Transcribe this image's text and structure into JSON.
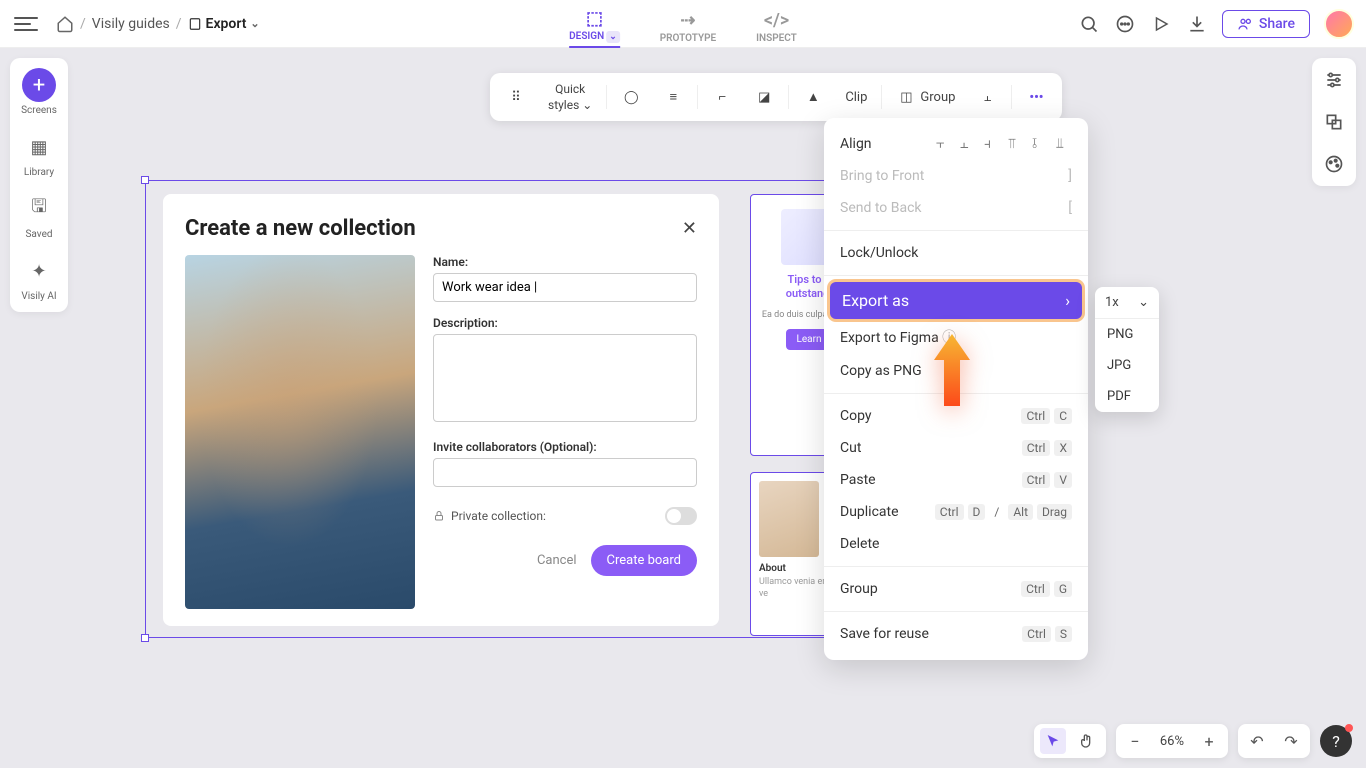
{
  "breadcrumb": {
    "guides": "Visily guides",
    "current": "Export"
  },
  "tabs": {
    "design": "DESIGN",
    "prototype": "PROTOTYPE",
    "inspect": "INSPECT"
  },
  "top_actions": {
    "share": "Share"
  },
  "left_sidebar": {
    "screens": "Screens",
    "library": "Library",
    "saved": "Saved",
    "ai": "Visily AI"
  },
  "toolbar": {
    "quick": "Quick",
    "styles": "styles",
    "clip": "Clip",
    "group": "Group"
  },
  "collection": {
    "title": "Create a new collection",
    "name_label": "Name:",
    "name_value": "Work wear idea |",
    "desc_label": "Description:",
    "invite_label": "Invite collaborators (Optional):",
    "private": "Private collection:",
    "cancel": "Cancel",
    "create": "Create board"
  },
  "tips": {
    "title_l1": "Tips to b",
    "title_l2": "outstandi",
    "desc": "Ea do duis culpa incidid",
    "learn": "Learn"
  },
  "about": {
    "label": "About",
    "desc": "Ullamco venia enim esse ve"
  },
  "context_menu": {
    "align": "Align",
    "bring_front": "Bring to Front",
    "send_back": "Send to Back",
    "lock": "Lock/Unlock",
    "export_as": "Export as",
    "export_figma": "Export to Figma",
    "copy_png": "Copy as PNG",
    "copy": "Copy",
    "copy_k": "Ctrl",
    "copy_k2": "C",
    "cut": "Cut",
    "cut_k2": "X",
    "paste": "Paste",
    "paste_k2": "V",
    "duplicate": "Duplicate",
    "dup_k2": "D",
    "dup_sep": "/",
    "dup_alt": "Alt",
    "dup_drag": "Drag",
    "delete": "Delete",
    "group": "Group",
    "group_k2": "G",
    "save_reuse": "Save for reuse",
    "save_k2": "S"
  },
  "submenu": {
    "head": "1x",
    "png": "PNG",
    "jpg": "JPG",
    "pdf": "PDF"
  },
  "zoom": {
    "text": "66%"
  }
}
